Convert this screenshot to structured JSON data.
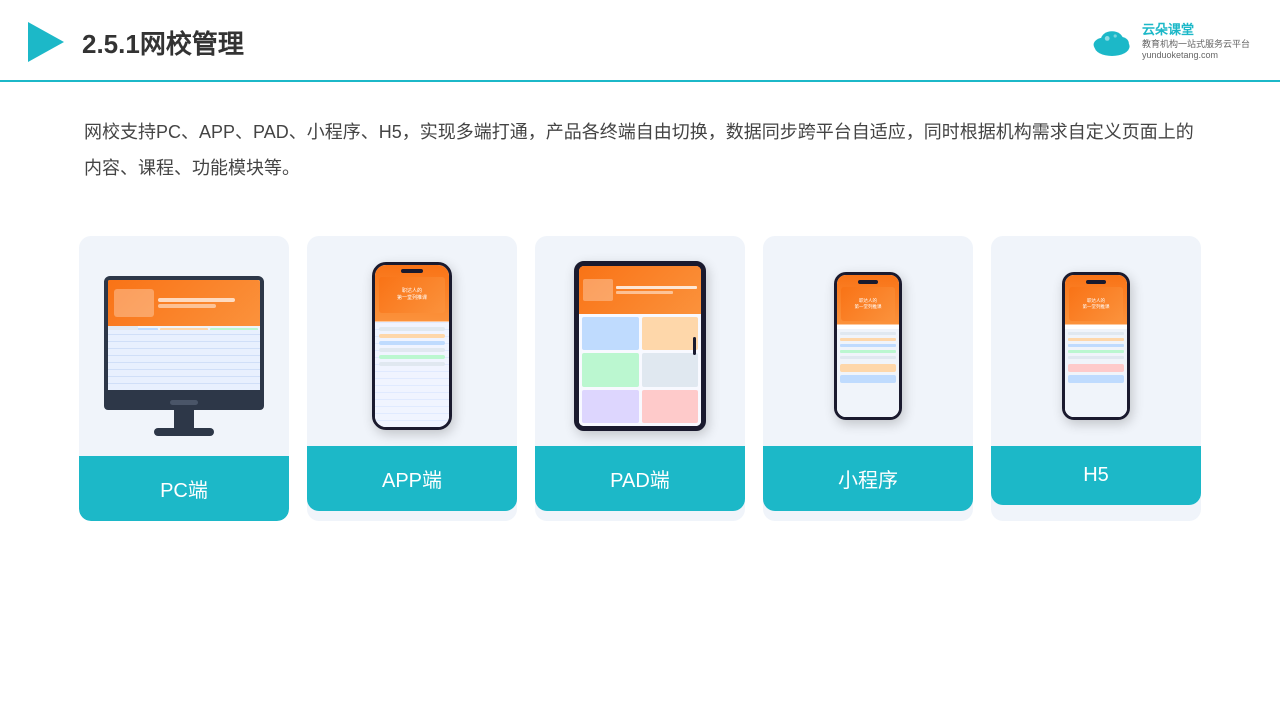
{
  "header": {
    "title": "2.5.1网校管理",
    "logo": {
      "name": "云朵课堂",
      "tagline": "教育机构一站式服务云平台",
      "domain": "yunduoketang.com"
    }
  },
  "description": "网校支持PC、APP、PAD、小程序、H5，实现多端打通，产品各终端自由切换，数据同步跨平台自适应，同时根据机构需求自定义页面上的内容、课程、功能模块等。",
  "cards": [
    {
      "id": "pc",
      "label": "PC端"
    },
    {
      "id": "app",
      "label": "APP端"
    },
    {
      "id": "pad",
      "label": "PAD端"
    },
    {
      "id": "miniprogram",
      "label": "小程序"
    },
    {
      "id": "h5",
      "label": "H5"
    }
  ],
  "colors": {
    "accent": "#1cb8c8",
    "dark": "#333",
    "label_bg": "#1cb8c8"
  }
}
